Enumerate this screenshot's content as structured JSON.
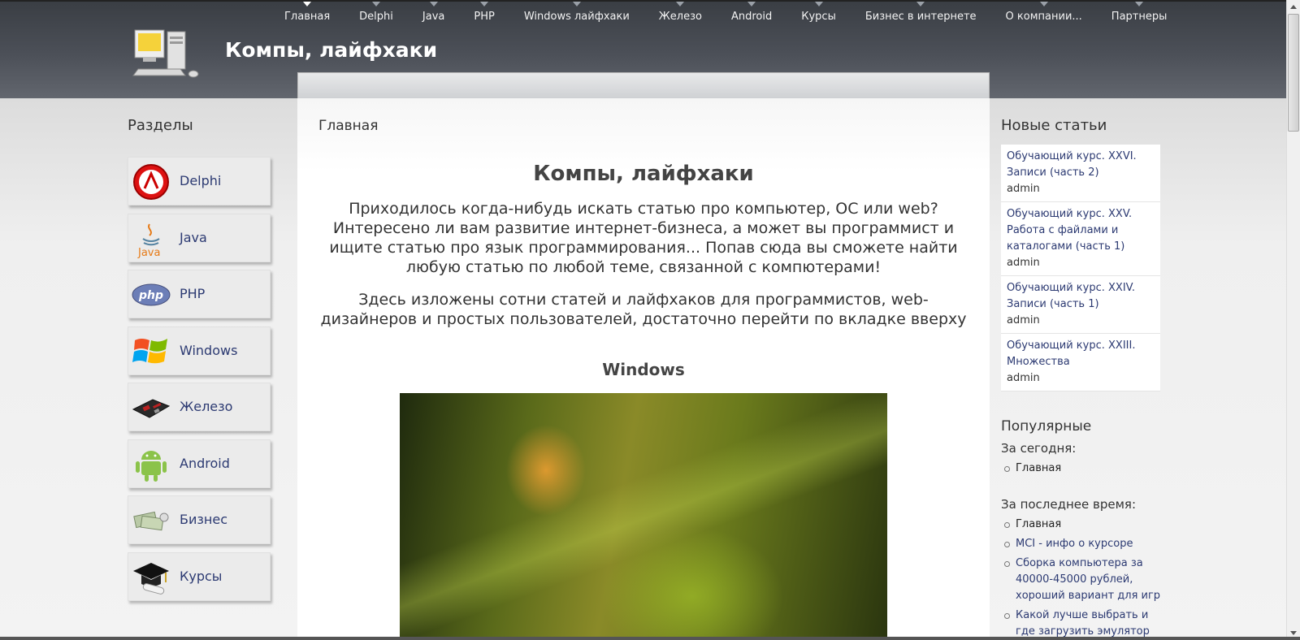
{
  "nav": {
    "items": [
      "Главная",
      "Delphi",
      "Java",
      "PHP",
      "Windows лайфхаки",
      "Железо",
      "Android",
      "Курсы",
      "Бизнес в интернете",
      "О компании...",
      "Партнеры"
    ]
  },
  "header": {
    "title": "Компы, лайфхаки"
  },
  "left": {
    "title": "Разделы",
    "categories": [
      {
        "label": "Delphi",
        "icon": "delphi-logo-icon"
      },
      {
        "label": "Java",
        "icon": "java-logo-icon"
      },
      {
        "label": "PHP",
        "icon": "php-logo-icon"
      },
      {
        "label": "Windows",
        "icon": "windows-logo-icon"
      },
      {
        "label": "Железо",
        "icon": "motherboard-icon"
      },
      {
        "label": "Android",
        "icon": "android-robot-icon"
      },
      {
        "label": "Бизнес",
        "icon": "money-icon"
      },
      {
        "label": "Курсы",
        "icon": "graduation-cap-icon"
      }
    ]
  },
  "main": {
    "breadcrumb": "Главная",
    "title": "Компы, лайфхаки",
    "paragraph1": "Приходилось когда-нибудь искать статью про компьютер, ОС или web? Интересено ли вам развитие интернет-бизнеса, а может вы программист и ищите статью про язык программирования... Попав сюда вы сможете найти любую статью по любой теме, связанной с компютерами!",
    "paragraph2": "Здесь изложены сотни статей и лайфхаков для программистов, web-дизайнеров и простых пользователей, достаточно перейти по вкладке вверху",
    "section_heading": "Windows"
  },
  "right": {
    "new_title": "Новые статьи",
    "articles": [
      {
        "title": "Обучающий курс. XXVI. Записи (часть 2)",
        "author": "admin"
      },
      {
        "title": "Обучающий курс. XXV. Работа с файлами и каталогами (часть 1)",
        "author": "admin"
      },
      {
        "title": "Обучающий курс. XXIV. Записи (часть 1)",
        "author": "admin"
      },
      {
        "title": "Обучающий курс. XXIII. Множества",
        "author": "admin"
      }
    ],
    "popular_title": "Популярные",
    "today_label": "За сегодня:",
    "today": [
      "Главная"
    ],
    "recent_label": "За последнее время:",
    "recent": [
      "Главная",
      "MCI - инфо о курсоре",
      "Сборка компьютера за 40000-45000 рублей, хороший вариант для игр",
      "Какой лучше выбрать и где загрузить эмулятор"
    ]
  },
  "colors": {
    "header_bg": "#4c5058",
    "link": "#2c3a72",
    "nav_text": "#f2f2f2"
  }
}
